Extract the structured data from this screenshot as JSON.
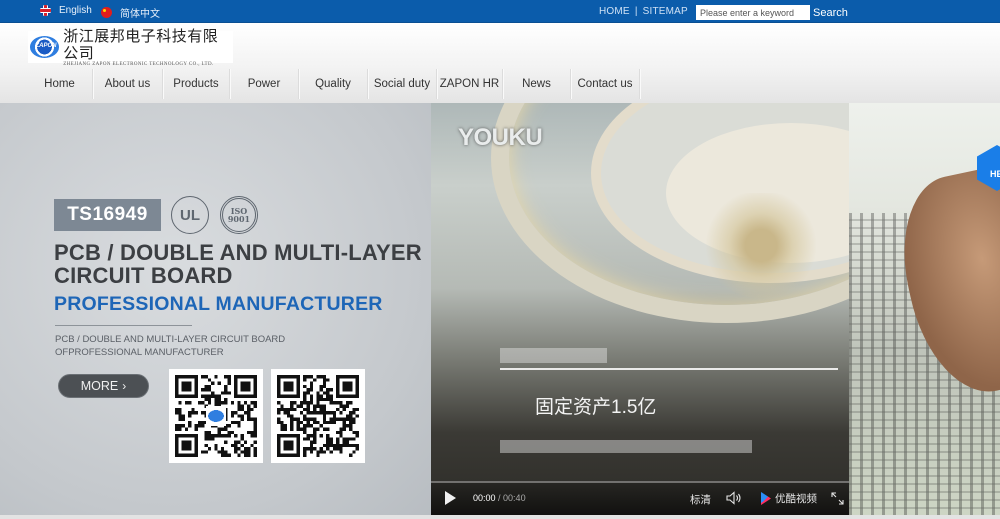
{
  "topbar": {
    "languages": [
      {
        "label": "English",
        "icon": "uk-flag-icon"
      },
      {
        "label": "简体中文",
        "icon": "china-flag-icon"
      }
    ],
    "links": [
      {
        "label": "HOME"
      },
      {
        "label": "SITEMAP"
      }
    ],
    "separator": "|",
    "search": {
      "placeholder": "Please enter a keyword",
      "value": "",
      "button_label": "Search"
    }
  },
  "header": {
    "logo": {
      "mark_text": "ZAPON",
      "name_cn": "浙江展邦电子科技有限公司",
      "name_en": "ZHEJIANG ZAPON ELECTRONIC TECHNOLOGY CO., LTD."
    },
    "nav": [
      {
        "label": "Home"
      },
      {
        "label": "About us"
      },
      {
        "label": "Products"
      },
      {
        "label": "Power"
      },
      {
        "label": "Quality"
      },
      {
        "label": "Social duty"
      },
      {
        "label": "ZAPON HR"
      },
      {
        "label": "News"
      },
      {
        "label": "Contact us"
      }
    ]
  },
  "hero": {
    "badge": "TS16949",
    "certs": [
      {
        "label": "UL",
        "icon": "ul-cert-icon"
      },
      {
        "label": "ISO 9001",
        "icon": "iso-9001-cert-icon"
      }
    ],
    "title": "PCB / DOUBLE AND MULTI-LAYER CIRCUIT BOARD",
    "subtitle": "PROFESSIONAL MANUFACTURER",
    "description_line1": "PCB / DOUBLE AND MULTI-LAYER CIRCUIT BOARD",
    "description_line2": "OFPROFESSIONAL MANUFACTURER",
    "more_label": "MORE",
    "more_icon": "chevron-right-icon",
    "qr_codes": [
      {
        "name": "qr-code-wechat",
        "has_logo": true
      },
      {
        "name": "qr-code-mobile",
        "has_logo": false
      }
    ]
  },
  "video": {
    "watermark": "YOUKU",
    "caption": "固定资产1.5亿",
    "current_time": "00:00",
    "duration": "00:40",
    "time_separator": " / ",
    "progress": 0,
    "quality_label": "标清",
    "brand_label": "优酷视频",
    "accent_color": "#2a9df4"
  },
  "side_widget": {
    "label": "HE",
    "color": "#1a7ee8"
  },
  "colors": {
    "topbar": "#0b5cab",
    "subtitle_blue": "#1e66b7",
    "badge_gray": "#7d8894"
  }
}
